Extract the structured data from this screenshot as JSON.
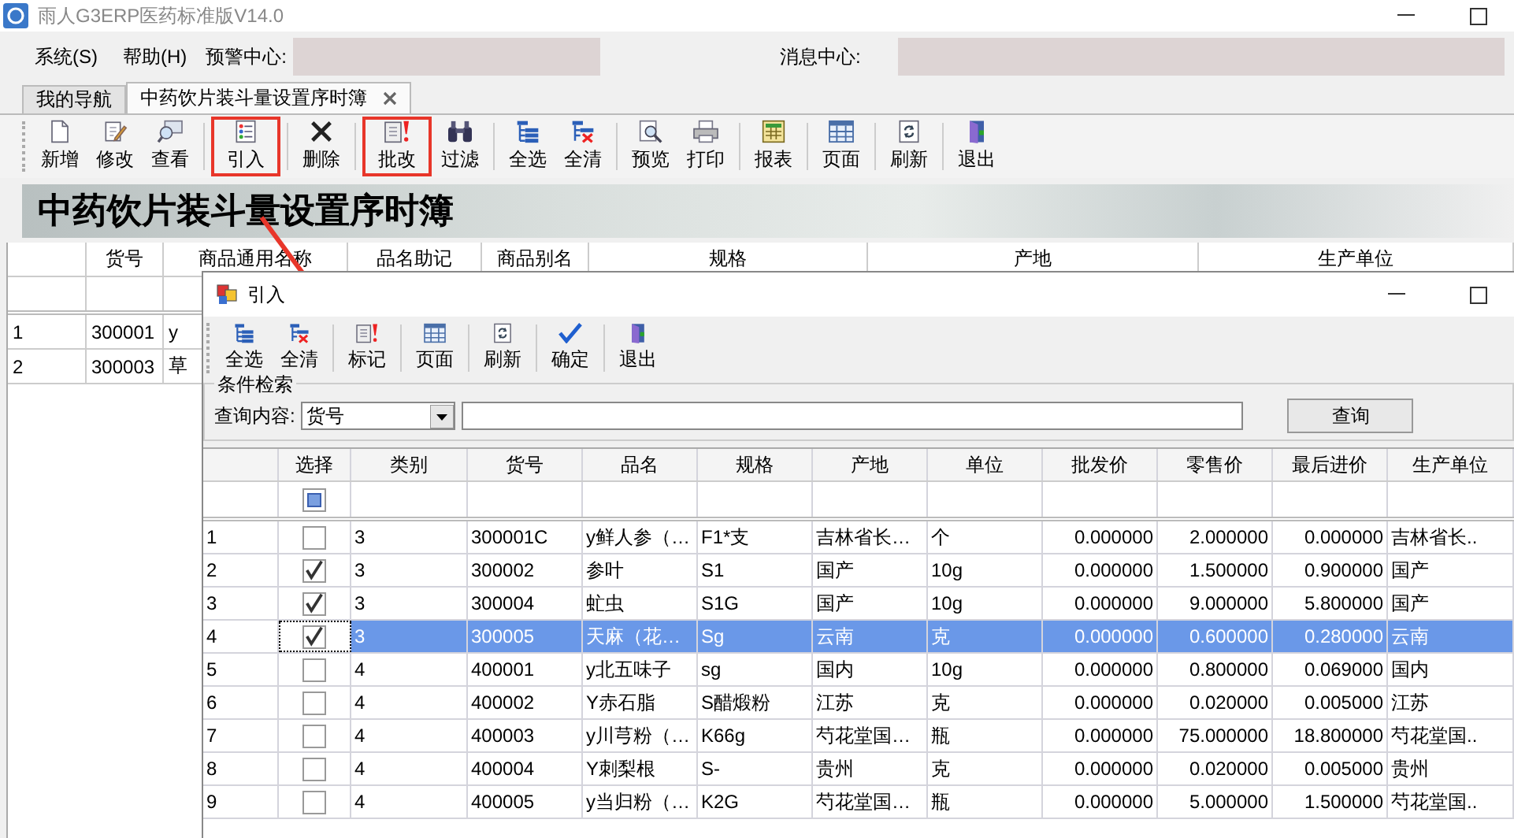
{
  "window": {
    "title": "雨人G3ERP医药标准版V14.0"
  },
  "menu": [
    {
      "label": "系统(S)"
    },
    {
      "label": "帮助(H)"
    }
  ],
  "alerts": {
    "warning_label": "预警中心:",
    "message_label": "消息中心:"
  },
  "tabs": [
    {
      "label": "我的导航",
      "selected": false,
      "closable": false
    },
    {
      "label": "中药饮片装斗量设置序时簿",
      "selected": true,
      "closable": true
    }
  ],
  "toolbar": [
    [
      {
        "label": "新增",
        "kind": "new",
        "highlighted": false
      },
      {
        "label": "修改",
        "kind": "edit",
        "highlighted": false
      },
      {
        "label": "查看",
        "kind": "view",
        "highlighted": false
      }
    ],
    [
      {
        "label": "引入",
        "kind": "import",
        "highlighted": true
      }
    ],
    [
      {
        "label": "删除",
        "kind": "delete",
        "highlighted": false
      }
    ],
    [
      {
        "label": "批改",
        "kind": "batch",
        "highlighted": true
      },
      {
        "label": "过滤",
        "kind": "filter",
        "highlighted": false
      }
    ],
    [
      {
        "label": "全选",
        "kind": "selectall",
        "highlighted": false
      },
      {
        "label": "全清",
        "kind": "clearall",
        "highlighted": false
      }
    ],
    [
      {
        "label": "预览",
        "kind": "preview",
        "highlighted": false
      },
      {
        "label": "打印",
        "kind": "print",
        "highlighted": false
      }
    ],
    [
      {
        "label": "报表",
        "kind": "report",
        "highlighted": false
      }
    ],
    [
      {
        "label": "页面",
        "kind": "page",
        "highlighted": false
      }
    ],
    [
      {
        "label": "刷新",
        "kind": "refresh",
        "highlighted": false
      }
    ],
    [
      {
        "label": "退出",
        "kind": "exit",
        "highlighted": false
      }
    ]
  ],
  "banner": {
    "title": "中药饮片装斗量设置序时簿"
  },
  "table": {
    "columns": [
      "货号",
      "商品通用名称",
      "品名助记",
      "商品别名",
      "规格",
      "产地",
      "生产单位"
    ],
    "rows": [
      {
        "number": "1",
        "cells": [
          "300001",
          "y"
        ]
      },
      {
        "number": "2",
        "cells": [
          "300003",
          "草"
        ]
      }
    ]
  },
  "dialog": {
    "title": "引入",
    "toolbar": [
      [
        {
          "label": "全选",
          "kind": "selectall"
        },
        {
          "label": "全清",
          "kind": "clearall"
        }
      ],
      [
        {
          "label": "标记",
          "kind": "batch"
        }
      ],
      [
        {
          "label": "页面",
          "kind": "page"
        }
      ],
      [
        {
          "label": "刷新",
          "kind": "refresh"
        }
      ],
      [
        {
          "label": "确定",
          "kind": "confirm"
        }
      ],
      [
        {
          "label": "退出",
          "kind": "exit"
        }
      ]
    ],
    "search": {
      "group_title": "条件检索",
      "label": "查询内容:",
      "field": "货号",
      "button": "查询"
    },
    "table": {
      "select_column": "选择",
      "columns": [
        "类别",
        "货号",
        "品名",
        "规格",
        "产地",
        "单位",
        "批发价",
        "零售价",
        "最后进价",
        "生产单位"
      ],
      "header_check_partial": true,
      "rows": [
        {
          "number": "1",
          "checked": false,
          "selected": false,
          "cells": [
            "3",
            "300001C",
            "y鲜人参（…",
            "F1*支",
            "吉林省长…",
            "个",
            "0.000000",
            "2.000000",
            "0.000000",
            "吉林省长.."
          ]
        },
        {
          "number": "2",
          "checked": true,
          "selected": false,
          "cells": [
            "3",
            "300002",
            "参叶",
            "S1",
            "国产",
            "10g",
            "0.000000",
            "1.500000",
            "0.900000",
            "国产"
          ]
        },
        {
          "number": "3",
          "checked": true,
          "selected": false,
          "cells": [
            "3",
            "300004",
            "虻虫",
            "S1G",
            "国产",
            "10g",
            "0.000000",
            "9.000000",
            "5.800000",
            "国产"
          ]
        },
        {
          "number": "4",
          "checked": true,
          "selected": true,
          "cells": [
            "3",
            "300005",
            "天麻（花…",
            "Sg",
            "云南",
            "克",
            "0.000000",
            "0.600000",
            "0.280000",
            "云南"
          ]
        },
        {
          "number": "5",
          "checked": false,
          "selected": false,
          "cells": [
            "4",
            "400001",
            "y北五味子",
            "sg",
            "国内",
            "10g",
            "0.000000",
            "0.800000",
            "0.069000",
            "国内"
          ]
        },
        {
          "number": "6",
          "checked": false,
          "selected": false,
          "cells": [
            "4",
            "400002",
            "Y赤石脂",
            "S醋煅粉",
            "江苏",
            "克",
            "0.000000",
            "0.020000",
            "0.005000",
            "江苏"
          ]
        },
        {
          "number": "7",
          "checked": false,
          "selected": false,
          "cells": [
            "4",
            "400003",
            "y川芎粉（…",
            "K66g",
            "芍花堂国…",
            "瓶",
            "0.000000",
            "75.000000",
            "18.800000",
            "芍花堂国.."
          ]
        },
        {
          "number": "8",
          "checked": false,
          "selected": false,
          "cells": [
            "4",
            "400004",
            "Y刺梨根",
            "S-",
            "贵州",
            "克",
            "0.000000",
            "0.020000",
            "0.005000",
            "贵州"
          ]
        },
        {
          "number": "9",
          "checked": false,
          "selected": false,
          "cells": [
            "4",
            "400005",
            "y当归粉（…",
            "K2G",
            "芍花堂国…",
            "瓶",
            "0.000000",
            "5.000000",
            "1.500000",
            "芍花堂国.."
          ]
        }
      ]
    }
  }
}
